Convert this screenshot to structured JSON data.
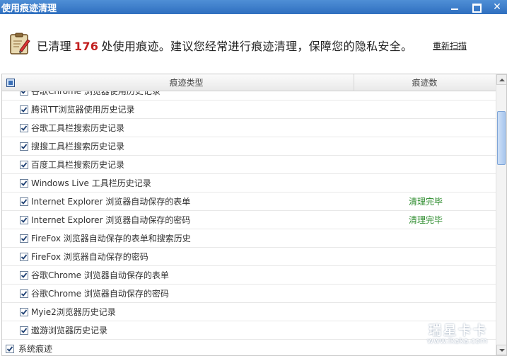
{
  "window": {
    "title": "使用痕迹清理"
  },
  "summary": {
    "prefix": "已清理",
    "count": "176",
    "suffix": "处使用痕迹。建议您经常进行痕迹清理，保障您的隐私安全。",
    "rescan_label": "重新扫描"
  },
  "table": {
    "col_type": "痕迹类型",
    "col_count": "痕迹数",
    "rows": [
      {
        "label": "谷歌Chrome 浏览器使用历史记录",
        "status": ""
      },
      {
        "label": "腾讯TT浏览器使用历史记录",
        "status": ""
      },
      {
        "label": "谷歌工具栏搜索历史记录",
        "status": ""
      },
      {
        "label": "搜搜工具栏搜索历史记录",
        "status": ""
      },
      {
        "label": "百度工具栏搜索历史记录",
        "status": ""
      },
      {
        "label": "Windows Live 工具栏历史记录",
        "status": ""
      },
      {
        "label": "Internet Explorer 浏览器自动保存的表单",
        "status": "清理完毕"
      },
      {
        "label": "Internet Explorer 浏览器自动保存的密码",
        "status": "清理完毕"
      },
      {
        "label": "FireFox 浏览器自动保存的表单和搜索历史",
        "status": ""
      },
      {
        "label": "FireFox 浏览器自动保存的密码",
        "status": ""
      },
      {
        "label": "谷歌Chrome 浏览器自动保存的表单",
        "status": ""
      },
      {
        "label": "谷歌Chrome 浏览器自动保存的密码",
        "status": ""
      },
      {
        "label": "Myie2浏览器历史记录",
        "status": ""
      },
      {
        "label": "遨游浏览器历史记录",
        "status": ""
      }
    ],
    "group_row": {
      "label": "系统痕迹"
    }
  },
  "watermark": {
    "cn": "瑞星卡卡",
    "url": "www.ikaka.com"
  },
  "colors": {
    "title_bar": "#2f6fbf",
    "count_red": "#c21f1f",
    "status_green": "#2a8a2a"
  }
}
